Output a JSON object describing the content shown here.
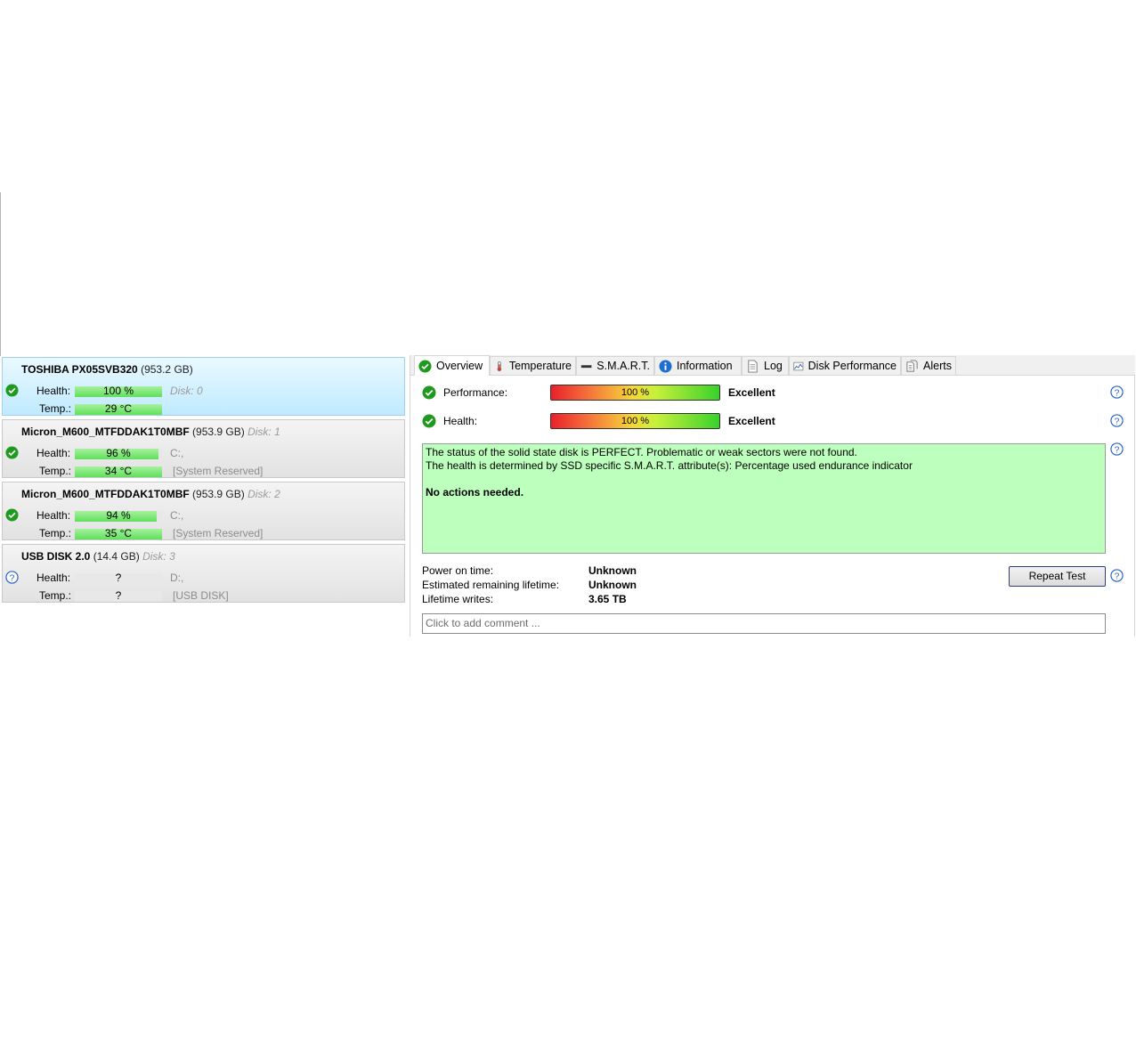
{
  "disks": [
    {
      "name": "TOSHIBA PX05SVB320",
      "size": "(953.2 GB)",
      "disk": "",
      "health_label": "Health:",
      "health": "100 %",
      "health_value": 100,
      "disk_note": "Disk: 0",
      "temp_label": "Temp.:",
      "temp": "29 °C",
      "temp_fill": 100,
      "temp_note": "",
      "status": "ok"
    },
    {
      "name": "Micron_M600_MTFDDAK1T0MBF",
      "size": "(953.9 GB)",
      "disk": "Disk: 1",
      "health_label": "Health:",
      "health": "96 %",
      "health_value": 96,
      "disk_note": "C:,",
      "temp_label": "Temp.:",
      "temp": "34 °C",
      "temp_fill": 100,
      "temp_note": "[System Reserved]",
      "status": "ok"
    },
    {
      "name": "Micron_M600_MTFDDAK1T0MBF",
      "size": "(953.9 GB)",
      "disk": "Disk: 2",
      "health_label": "Health:",
      "health": "94 %",
      "health_value": 94,
      "disk_note": "C:,",
      "temp_label": "Temp.:",
      "temp": "35 °C",
      "temp_fill": 100,
      "temp_note": "[System Reserved]",
      "status": "ok"
    },
    {
      "name": "USB DISK 2.0",
      "size": "(14.4 GB)",
      "disk": "Disk: 3",
      "health_label": "Health:",
      "health": "?",
      "health_value": 0,
      "disk_note": "D:,",
      "temp_label": "Temp.:",
      "temp": "?",
      "temp_fill": 0,
      "temp_note": "[USB DISK]",
      "status": "unknown"
    }
  ],
  "tabs": [
    {
      "label": "Overview",
      "icon": "check-circle-icon"
    },
    {
      "label": "Temperature",
      "icon": "thermometer-icon"
    },
    {
      "label": "S.M.A.R.T.",
      "icon": "smart-bar-icon"
    },
    {
      "label": "Information",
      "icon": "info-icon"
    },
    {
      "label": "Log",
      "icon": "document-icon"
    },
    {
      "label": "Disk Performance",
      "icon": "chart-icon"
    },
    {
      "label": "Alerts",
      "icon": "alerts-icon"
    }
  ],
  "overview": {
    "performance_label": "Performance:",
    "performance_value": "100 %",
    "performance_rating": "Excellent",
    "health_label": "Health:",
    "health_value": "100 %",
    "health_rating": "Excellent",
    "status_line1": "The status of the solid state disk is PERFECT. Problematic or weak sectors were not found.",
    "status_line2": "The health is determined by SSD specific S.M.A.R.T. attribute(s):  Percentage used endurance indicator",
    "status_line3": "No actions needed.",
    "power_on_label": "Power on time:",
    "power_on_value": "Unknown",
    "remaining_label": "Estimated remaining lifetime:",
    "remaining_value": "Unknown",
    "writes_label": "Lifetime writes:",
    "writes_value": "3.65 TB",
    "repeat_button": "Repeat Test",
    "comment_placeholder": "Click to add comment ..."
  },
  "colors": {
    "ok": "#1f9a1f",
    "help": "#2b66c9",
    "status_bg": "#bdffbd",
    "selected_bg": "#bfeaff"
  }
}
